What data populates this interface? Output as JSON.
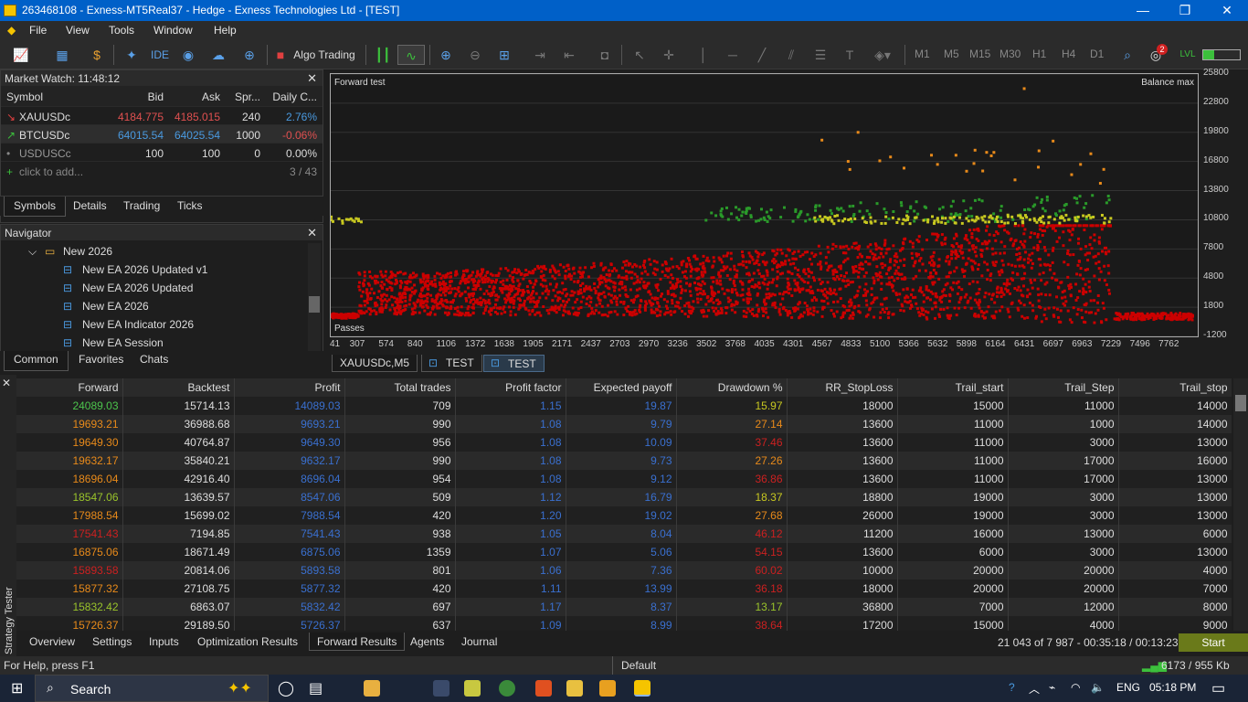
{
  "window": {
    "title": "263468108 - Exness-MT5Real37 - Hedge - Exness Technologies Ltd - [TEST]",
    "min": "—",
    "restore": "❐",
    "close": "✕"
  },
  "menu": [
    "File",
    "View",
    "Tools",
    "Window",
    "Help"
  ],
  "toolbar": {
    "algo": "Algo Trading",
    "ide": "IDE",
    "timeframes": [
      "M1",
      "M5",
      "M15",
      "M30",
      "H1",
      "H4",
      "D1"
    ],
    "badge": "2"
  },
  "market_watch": {
    "title": "Market Watch: 11:48:12",
    "headers": [
      "Symbol",
      "Bid",
      "Ask",
      "Spr...",
      "Daily C..."
    ],
    "rows": [
      {
        "arrow": "↘",
        "symbol": "XAUUSDc",
        "bid": "4184.775",
        "ask": "4185.015",
        "spread": "240",
        "change": "2.76%"
      },
      {
        "arrow": "↗",
        "symbol": "BTCUSDc",
        "bid": "64015.54",
        "ask": "64025.54",
        "spread": "1000",
        "change": "-0.06%"
      },
      {
        "arrow": "•",
        "symbol": "USDUSCc",
        "bid": "100",
        "ask": "100",
        "spread": "0",
        "change": "0.00%"
      }
    ],
    "add": "click to add...",
    "count": "3 / 43",
    "tabs": [
      "Symbols",
      "Details",
      "Trading",
      "Ticks"
    ]
  },
  "navigator": {
    "title": "Navigator",
    "folder": "New 2026",
    "items": [
      "New EA 2026 Updated v1",
      "New EA 2026 Updated",
      "New EA 2026",
      "New EA Indicator 2026",
      "New EA Session"
    ],
    "tabs": [
      "Common",
      "Favorites",
      "Chats"
    ]
  },
  "chart": {
    "label_left": "Forward test",
    "label_right": "Balance max",
    "label_passes": "Passes",
    "yticks": [
      "25800",
      "22800",
      "19800",
      "16800",
      "13800",
      "10800",
      "7800",
      "4800",
      "1800",
      "-1200"
    ],
    "xticks": [
      "41",
      "307",
      "574",
      "840",
      "1106",
      "1372",
      "1638",
      "1905",
      "2171",
      "2437",
      "2703",
      "2970",
      "3236",
      "3502",
      "3768",
      "4035",
      "4301",
      "4567",
      "4833",
      "5100",
      "5366",
      "5632",
      "5898",
      "6164",
      "6431",
      "6697",
      "6963",
      "7229",
      "7496",
      "7762"
    ],
    "tabs": [
      "XAUUSDc,M5",
      "TEST",
      "TEST"
    ]
  },
  "chart_data": {
    "type": "scatter",
    "title": "",
    "xlabel": "Passes",
    "ylabel": "",
    "xlim": [
      41,
      8030
    ],
    "ylim": [
      -1200,
      25800
    ],
    "series": [
      {
        "name": "",
        "color": "#cc0000",
        "points": [
          [
            300,
            3300
          ],
          [
            1000,
            3200
          ],
          [
            2000,
            3500
          ],
          [
            3000,
            3800
          ],
          [
            4000,
            4200
          ],
          [
            5000,
            4600
          ],
          [
            6000,
            5200
          ],
          [
            6800,
            6000
          ],
          [
            7229,
            7200
          ],
          [
            7500,
            900
          ],
          [
            7900,
            900
          ]
        ]
      },
      {
        "name": "",
        "color": "#2a9a2a",
        "points": [
          [
            3500,
            12800
          ],
          [
            4300,
            10800
          ],
          [
            5500,
            13000
          ],
          [
            6164,
            13500
          ],
          [
            6800,
            13200
          ],
          [
            7100,
            14200
          ]
        ]
      },
      {
        "name": "",
        "color": "#e88a1a",
        "points": [
          [
            4567,
            19000
          ],
          [
            4900,
            19800
          ],
          [
            6431,
            24300
          ],
          [
            6697,
            18900
          ],
          [
            6950,
            16500
          ],
          [
            5632,
            16500
          ],
          [
            5900,
            15800
          ]
        ]
      },
      {
        "name": "",
        "color": "#c8c820",
        "points": [
          [
            41,
            11000
          ],
          [
            4567,
            11000
          ],
          [
            5366,
            10800
          ],
          [
            6164,
            10900
          ],
          [
            6963,
            10900
          ]
        ]
      }
    ]
  },
  "tester": {
    "side_label": "Strategy Tester",
    "headers": [
      "Forward",
      "Backtest",
      "Profit",
      "Total trades",
      "Profit factor",
      "Expected payoff",
      "Drawdown %",
      "RR_StopLoss",
      "Trail_start",
      "Trail_Step",
      "Trail_stop"
    ],
    "rows": [
      [
        "24089.03",
        "15714.13",
        "14089.03",
        "709",
        "1.15",
        "19.87",
        "15.97",
        "18000",
        "15000",
        "11000",
        "14000"
      ],
      [
        "19693.21",
        "36988.68",
        "9693.21",
        "990",
        "1.08",
        "9.79",
        "27.14",
        "13600",
        "11000",
        "1000",
        "14000"
      ],
      [
        "19649.30",
        "40764.87",
        "9649.30",
        "956",
        "1.08",
        "10.09",
        "37.46",
        "13600",
        "11000",
        "3000",
        "13000"
      ],
      [
        "19632.17",
        "35840.21",
        "9632.17",
        "990",
        "1.08",
        "9.73",
        "27.26",
        "13600",
        "11000",
        "17000",
        "16000"
      ],
      [
        "18696.04",
        "42916.40",
        "8696.04",
        "954",
        "1.08",
        "9.12",
        "36.86",
        "13600",
        "11000",
        "17000",
        "13000"
      ],
      [
        "18547.06",
        "13639.57",
        "8547.06",
        "509",
        "1.12",
        "16.79",
        "18.37",
        "18800",
        "19000",
        "3000",
        "13000"
      ],
      [
        "17988.54",
        "15699.02",
        "7988.54",
        "420",
        "1.20",
        "19.02",
        "27.68",
        "26000",
        "19000",
        "3000",
        "13000"
      ],
      [
        "17541.43",
        "7194.85",
        "7541.43",
        "938",
        "1.05",
        "8.04",
        "46.12",
        "11200",
        "16000",
        "13000",
        "6000"
      ],
      [
        "16875.06",
        "18671.49",
        "6875.06",
        "1359",
        "1.07",
        "5.06",
        "54.15",
        "13600",
        "6000",
        "3000",
        "13000"
      ],
      [
        "15893.58",
        "20814.06",
        "5893.58",
        "801",
        "1.06",
        "7.36",
        "60.02",
        "10000",
        "20000",
        "20000",
        "4000"
      ],
      [
        "15877.32",
        "27108.75",
        "5877.32",
        "420",
        "1.11",
        "13.99",
        "36.18",
        "18000",
        "20000",
        "20000",
        "7000"
      ],
      [
        "15832.42",
        "6863.07",
        "5832.42",
        "697",
        "1.17",
        "8.37",
        "13.17",
        "36800",
        "7000",
        "12000",
        "8000"
      ],
      [
        "15726.37",
        "29189.50",
        "5726.37",
        "637",
        "1.09",
        "8.99",
        "38.64",
        "17200",
        "15000",
        "4000",
        "9000"
      ]
    ],
    "forward_colors": [
      "#4cc44c",
      "#e88a1a",
      "#e88a1a",
      "#e88a1a",
      "#e88a1a",
      "#9ac42a",
      "#e88a1a",
      "#cc2020",
      "#e88a1a",
      "#cc2020",
      "#e88a1a",
      "#9ac42a",
      "#e88a1a"
    ],
    "dd_colors": [
      "#c8c820",
      "#e88a1a",
      "#cc2020",
      "#e88a1a",
      "#cc2020",
      "#c8c820",
      "#e88a1a",
      "#cc2020",
      "#cc2020",
      "#cc2020",
      "#cc2020",
      "#9ac42a",
      "#cc2020"
    ],
    "tabs": [
      "Overview",
      "Settings",
      "Inputs",
      "Optimization Results",
      "Forward Results",
      "Agents",
      "Journal"
    ],
    "progress": "21 043 of 7 987  -  00:35:18 / 00:13:23",
    "start": "Start"
  },
  "status": {
    "help": "For Help, press F1",
    "profile": "Default",
    "net": "6173 / 955 Kb"
  },
  "taskbar": {
    "search": "Search",
    "lang": "ENG",
    "time": "05:18 PM"
  }
}
